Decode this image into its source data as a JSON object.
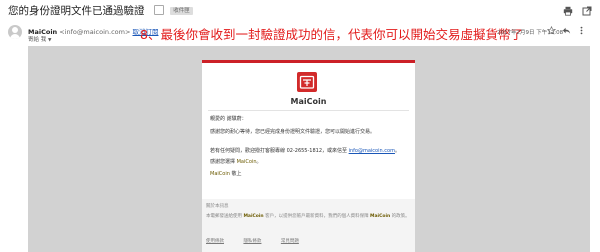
{
  "header": {
    "subject": "您的身份證明文件已通過驗證",
    "label_badge": "收件匣"
  },
  "message": {
    "sender_name": "MaiCoin",
    "sender_email": "<info@maicoin.com>",
    "unsubscribe_label": "取消訂閱",
    "recipient_label": "寄給 我",
    "datetime": "2017年2月9日 下午12:08"
  },
  "annotation": "8、最後你會收到一封驗證成功的信，代表你可以開始交易虛擬貨幣了",
  "email_body": {
    "brand_name": "MaiCoin",
    "greeting": "親愛的 謝騏蔚：",
    "verified_line": "感謝您的耐心等待，您已經完成身份證明文件驗證，您可以開始進行交易。",
    "contact_prefix": "若有任何疑問，歡迎撥打客服專線 02-2655-1812，或來信至",
    "contact_email": "info@maicoin.com",
    "contact_suffix": "。",
    "thanks_prefix": "感謝您選擇",
    "thanks_brand": "MaiCoin",
    "thanks_suffix": "。",
    "signoff_brand": "MaiCoin",
    "signoff_suffix": "敬上"
  },
  "footer": {
    "title": "關於本訊息",
    "text_prefix": "本電郵發送給使用",
    "text_brand_1": "MaiCoin",
    "text_middle": "客戶，以提供您帳戶最新資料，我們的個人資料保障",
    "text_brand_2": "MaiCoin",
    "text_suffix": "的政策。",
    "links": [
      "使用條款",
      "隱私條款",
      "常見問題"
    ]
  },
  "colors": {
    "annotation": "#e21a1a",
    "brand_red": "#cc2027",
    "link_blue": "#1a57b8",
    "canvas_gray": "#d2d2d2"
  },
  "icons": [
    "print-icon",
    "open-in-new-window-icon",
    "star-icon",
    "reply-icon",
    "more-options-icon",
    "avatar-icon",
    "maicoin-logo-icon"
  ]
}
